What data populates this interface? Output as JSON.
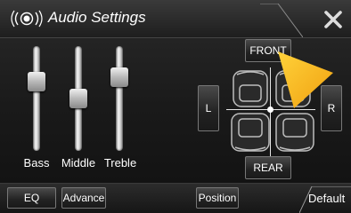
{
  "header": {
    "title": "Audio Settings"
  },
  "sliders": [
    {
      "label": "Bass",
      "level": 0.7
    },
    {
      "label": "Middle",
      "level": 0.5
    },
    {
      "label": "Treble",
      "level": 0.75
    }
  ],
  "balance": {
    "front": "FRONT",
    "rear": "REAR",
    "left": "L",
    "right": "R"
  },
  "bottom": {
    "eq": "EQ",
    "advance": "Advance",
    "position": "Position",
    "default": "Default"
  },
  "icons": {
    "speaker": "speaker-icon",
    "close": "close-icon",
    "arrow": "pointer-arrow-icon"
  },
  "colors": {
    "accent_arrow": "#f7b51c",
    "text": "#ffffff"
  }
}
